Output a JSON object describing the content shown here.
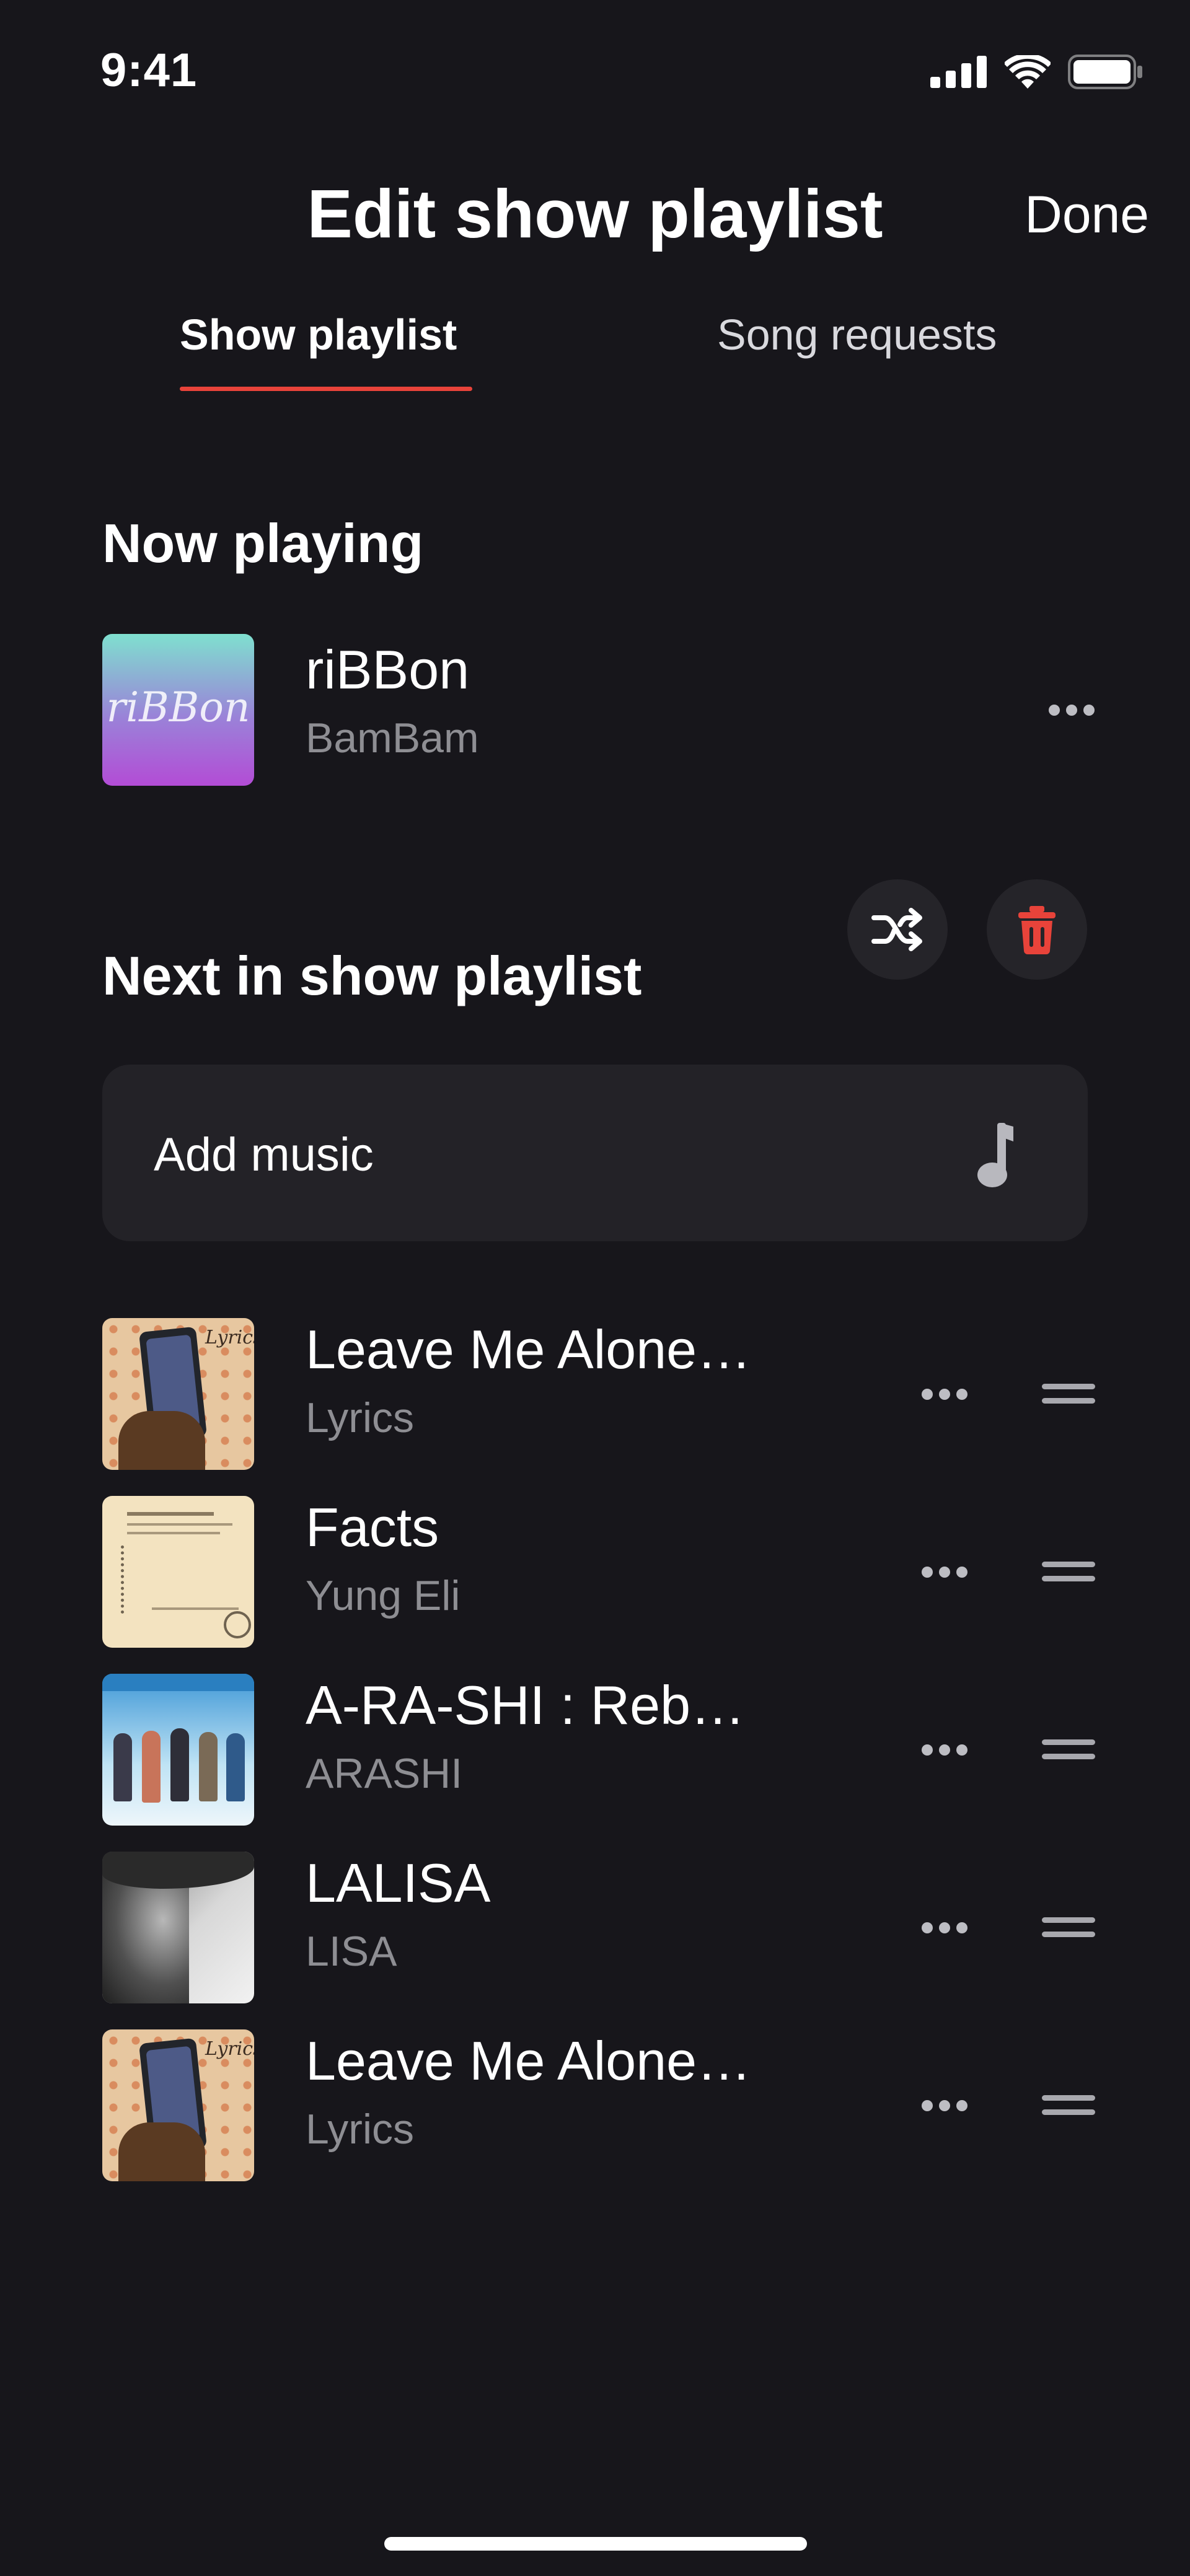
{
  "status_bar": {
    "time": "9:41"
  },
  "header": {
    "title": "Edit show playlist",
    "done_label": "Done"
  },
  "tabs": [
    {
      "label": "Show playlist",
      "active": true
    },
    {
      "label": "Song requests",
      "active": false
    }
  ],
  "now_playing": {
    "section_title": "Now playing",
    "track": {
      "title": "riBBon",
      "artist": "BamBam",
      "art_text": "riBBon"
    }
  },
  "next": {
    "section_title": "Next in show playlist",
    "add_music_label": "Add music",
    "tracks": [
      {
        "title": "Leave Me Alone…",
        "artist": "Lyrics",
        "art": "lyrics-cover"
      },
      {
        "title": "Facts",
        "artist": "Yung Eli",
        "art": "facts-cover"
      },
      {
        "title": "A-RA-SHI : Reb…",
        "artist": "ARASHI",
        "art": "arashi-cover"
      },
      {
        "title": "LALISA",
        "artist": "LISA",
        "art": "lalisa-cover"
      },
      {
        "title": "Leave Me Alone…",
        "artist": "Lyrics",
        "art": "lyrics-cover"
      }
    ]
  },
  "colors": {
    "background": "#17161b",
    "accent": "#e8433a",
    "card": "#232227",
    "secondary_text": "#8e8e93"
  },
  "icons": [
    "signal-icon",
    "wifi-icon",
    "battery-icon",
    "more-icon",
    "shuffle-icon",
    "trash-icon",
    "music-note-icon",
    "drag-handle-icon"
  ]
}
